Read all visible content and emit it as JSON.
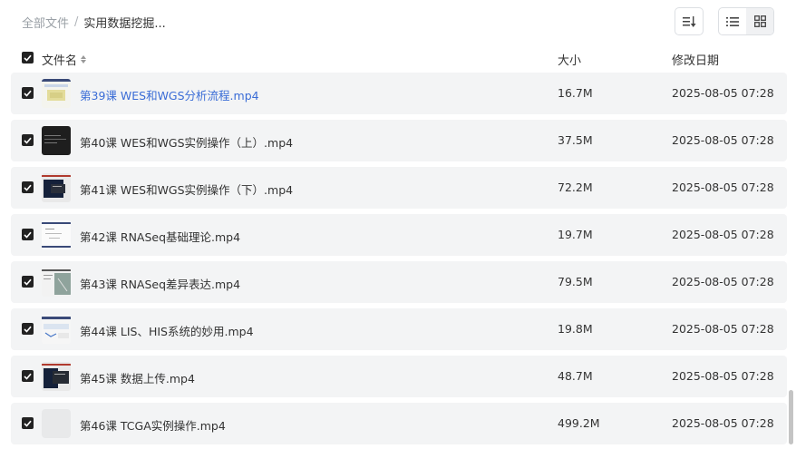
{
  "breadcrumb": {
    "root": "全部文件",
    "separator": "/",
    "current": "实用数据挖掘..."
  },
  "toolbar": {
    "sort_icon": "sort-lines-icon",
    "list_view_icon": "list-view-icon",
    "grid_view_icon": "grid-view-icon"
  },
  "columns": {
    "name": "文件名",
    "size": "大小",
    "modified": "修改日期"
  },
  "accent_color": "#3a6cd6",
  "files": [
    {
      "name": "第39课 WES和WGS分析流程.mp4",
      "size": "16.7M",
      "modified": "2025-08-05 07:28"
    },
    {
      "name": "第40课 WES和WGS实例操作（上）.mp4",
      "size": "37.5M",
      "modified": "2025-08-05 07:28"
    },
    {
      "name": "第41课 WES和WGS实例操作（下）.mp4",
      "size": "72.2M",
      "modified": "2025-08-05 07:28"
    },
    {
      "name": "第42课 RNASeq基础理论.mp4",
      "size": "19.7M",
      "modified": "2025-08-05 07:28"
    },
    {
      "name": "第43课 RNASeq差异表达.mp4",
      "size": "79.5M",
      "modified": "2025-08-05 07:28"
    },
    {
      "name": "第44课 LIS、HIS系统的妙用.mp4",
      "size": "19.8M",
      "modified": "2025-08-05 07:28"
    },
    {
      "name": "第45课 数据上传.mp4",
      "size": "48.7M",
      "modified": "2025-08-05 07:28"
    },
    {
      "name": "第46课 TCGA实例操作.mp4",
      "size": "499.2M",
      "modified": "2025-08-05 07:28"
    }
  ]
}
